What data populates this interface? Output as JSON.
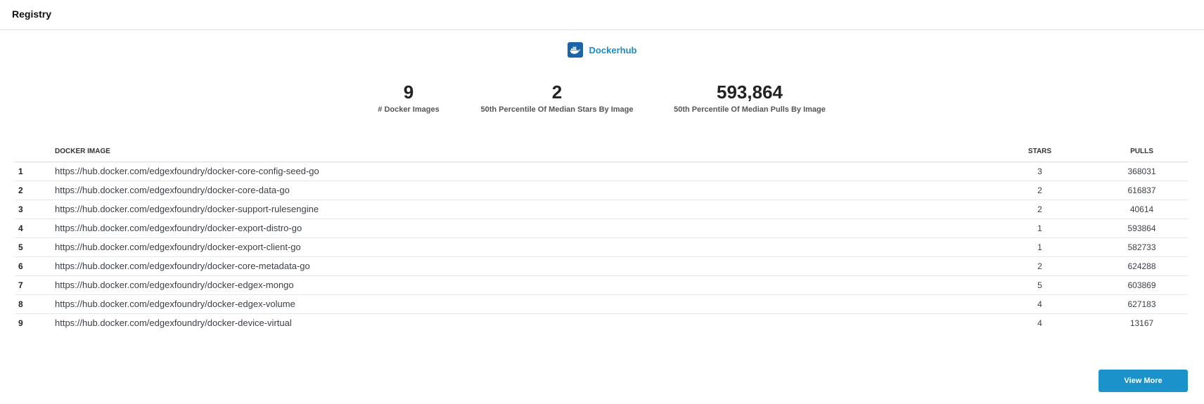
{
  "header": {
    "title": "Registry"
  },
  "provider": {
    "name": "Dockerhub",
    "logo_icon": "docker-whale-icon",
    "accent_color": "#1a8dc1"
  },
  "stats": [
    {
      "value": "9",
      "label": "# Docker Images"
    },
    {
      "value": "2",
      "label": "50th Percentile Of Median Stars By Image"
    },
    {
      "value": "593,864",
      "label": "50th Percentile Of Median Pulls By Image"
    }
  ],
  "table": {
    "headers": {
      "image": "DOCKER IMAGE",
      "stars": "STARS",
      "pulls": "PULLS"
    },
    "rows": [
      {
        "index": "1",
        "image": "https://hub.docker.com/edgexfoundry/docker-core-config-seed-go",
        "stars": "3",
        "pulls": "368031"
      },
      {
        "index": "2",
        "image": "https://hub.docker.com/edgexfoundry/docker-core-data-go",
        "stars": "2",
        "pulls": "616837"
      },
      {
        "index": "3",
        "image": "https://hub.docker.com/edgexfoundry/docker-support-rulesengine",
        "stars": "2",
        "pulls": "40614"
      },
      {
        "index": "4",
        "image": "https://hub.docker.com/edgexfoundry/docker-export-distro-go",
        "stars": "1",
        "pulls": "593864"
      },
      {
        "index": "5",
        "image": "https://hub.docker.com/edgexfoundry/docker-export-client-go",
        "stars": "1",
        "pulls": "582733"
      },
      {
        "index": "6",
        "image": "https://hub.docker.com/edgexfoundry/docker-core-metadata-go",
        "stars": "2",
        "pulls": "624288"
      },
      {
        "index": "7",
        "image": "https://hub.docker.com/edgexfoundry/docker-edgex-mongo",
        "stars": "5",
        "pulls": "603869"
      },
      {
        "index": "8",
        "image": "https://hub.docker.com/edgexfoundry/docker-edgex-volume",
        "stars": "4",
        "pulls": "627183"
      },
      {
        "index": "9",
        "image": "https://hub.docker.com/edgexfoundry/docker-device-virtual",
        "stars": "4",
        "pulls": "13167"
      }
    ]
  },
  "actions": {
    "view_more_label": "View More",
    "button_color": "#1b92c9"
  }
}
